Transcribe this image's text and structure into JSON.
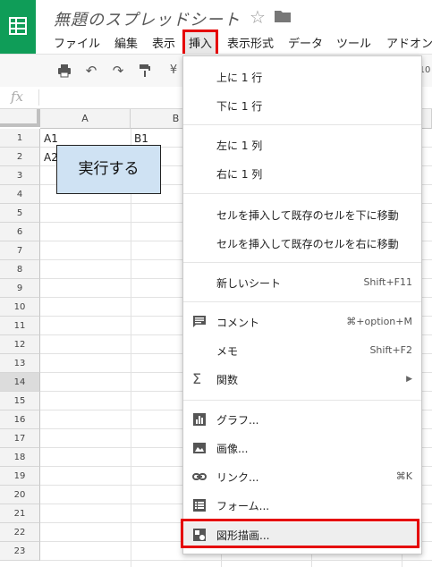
{
  "doc": {
    "title": "無題のスプレッドシート"
  },
  "menu": {
    "items": [
      "ファイル",
      "編集",
      "表示",
      "挿入",
      "表示形式",
      "データ",
      "ツール",
      "アドオン"
    ],
    "active": "挿入"
  },
  "toolbar": {
    "currency": "¥",
    "partial_text": "10"
  },
  "formula_bar": {
    "fx": "fx"
  },
  "sheet": {
    "columns": [
      "A",
      "B"
    ],
    "rows": [
      "1",
      "2",
      "3",
      "4",
      "5",
      "6",
      "7",
      "8",
      "9",
      "10",
      "11",
      "12",
      "13",
      "14",
      "15",
      "16",
      "17",
      "18",
      "19",
      "20",
      "21",
      "22",
      "23"
    ],
    "selected_row": "14",
    "cells": {
      "A1": "A1",
      "B1": "B1",
      "A2": "A2"
    },
    "button_label": "実行する"
  },
  "insert_menu": {
    "row_above": "上に 1 行",
    "row_below": "下に 1 行",
    "col_left": "左に 1 列",
    "col_right": "右に 1 列",
    "shift_down": "セルを挿入して既存のセルを下に移動",
    "shift_right": "セルを挿入して既存のセルを右に移動",
    "new_sheet": "新しいシート",
    "new_sheet_shortcut": "Shift+F11",
    "comment": "コメント",
    "comment_shortcut": "⌘+option+M",
    "memo": "メモ",
    "memo_shortcut": "Shift+F2",
    "function": "関数",
    "chart": "グラフ...",
    "image": "画像...",
    "link": "リンク...",
    "link_shortcut": "⌘K",
    "form": "フォーム...",
    "drawing": "図形描画..."
  },
  "colors": {
    "highlight_red": "#e50000",
    "logo_green": "#0f9d58",
    "button_blue": "#cfe2f3"
  }
}
